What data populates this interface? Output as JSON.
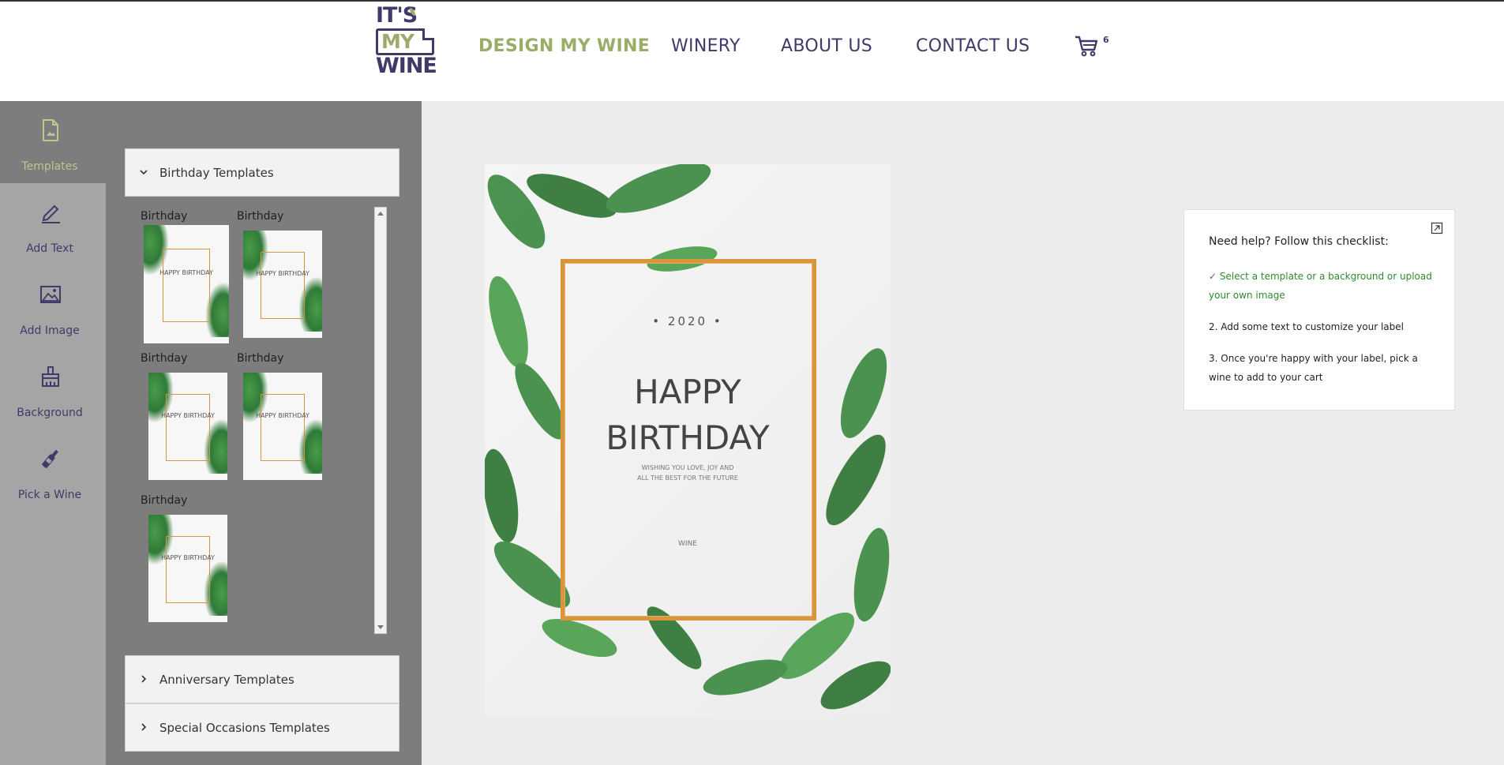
{
  "header": {
    "logo": {
      "line1": "IT'S",
      "line2": "MY",
      "line3": "WINE"
    },
    "nav": {
      "design": "DESIGN MY WINE",
      "winery": "WINERY",
      "about": "ABOUT US",
      "contact": "CONTACT US"
    },
    "cart_count": "6",
    "cart_icon": "cart-icon"
  },
  "tools": [
    {
      "label": "Templates",
      "icon": "template-file-icon",
      "active": true
    },
    {
      "label": "Add Text",
      "icon": "pencil-icon"
    },
    {
      "label": "Add Image",
      "icon": "image-icon"
    },
    {
      "label": "Background",
      "icon": "paint-brush-icon"
    },
    {
      "label": "Pick a Wine",
      "icon": "wine-bottle-icon"
    }
  ],
  "templates": {
    "birthday_title": "Birthday Templates",
    "anniversary_title": "Anniversary Templates",
    "special_title": "Special Occasions Templates",
    "items": [
      {
        "caption": "Birthday",
        "text": "HAPPY BIRTHDAY"
      },
      {
        "caption": "Birthday",
        "text": "HAPPY BIRTHDAY"
      },
      {
        "caption": "Birthday",
        "text": "HAPPY BIRTHDAY"
      },
      {
        "caption": "Birthday",
        "text": "HAPPY BIRTHDAY"
      },
      {
        "caption": "Birthday",
        "text": "HAPPY BIRTHDAY"
      }
    ]
  },
  "label": {
    "year": "• 2020 •",
    "line1": "HAPPY",
    "line2": "BIRTHDAY",
    "wish1": "WISHING YOU LOVE, JOY AND",
    "wish2": "ALL THE BEST FOR THE FUTURE",
    "signature": "WINE"
  },
  "help": {
    "title": "Need help? Follow this checklist:",
    "step1": "✓ Select a template or a background or upload your own image",
    "step2": "2. Add some text to customize your label",
    "step3": "3. Once you're happy with your label, pick a wine to add to your cart"
  },
  "colors": {
    "brand_purple": "#3f3a68",
    "brand_green": "#9aad67",
    "gold_frame": "#d8953c",
    "check_green": "#2f8a2f"
  }
}
